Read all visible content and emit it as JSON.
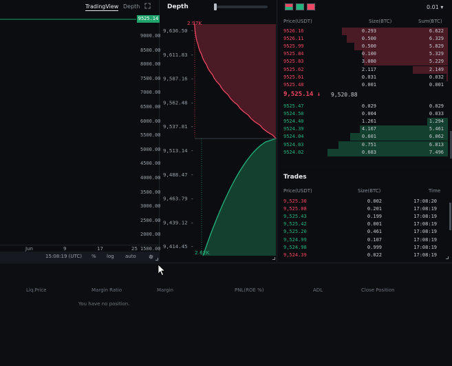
{
  "chart": {
    "tabs": [
      "TradingView",
      "Depth"
    ],
    "last_price_tag": "9525.14",
    "price_axis": [
      "9000.00",
      "8500.00",
      "8000.00",
      "7500.00",
      "7000.00",
      "6500.00",
      "6000.00",
      "5500.00",
      "5000.00",
      "4500.00",
      "4000.00",
      "3500.00",
      "3000.00",
      "2500.00",
      "2000.00",
      "1500.00"
    ],
    "time_axis": [
      "Jun",
      "9",
      "17",
      "25"
    ],
    "footer": {
      "time": "15:08:19 (UTC)",
      "percent": "%",
      "log": "log",
      "auto": "auto"
    }
  },
  "depth": {
    "title": "Depth",
    "y_axis": [
      "9,636.50 -",
      "9,611.83 -",
      "9,587.16 -",
      "9,562.48 -",
      "9,537.81 -",
      "9,513.14 -",
      "9,488.47 -",
      "9,463.79 -",
      "9,439.12 -",
      "9,414.45 -"
    ],
    "ask_total_label": "2.97K",
    "bid_total_label": "2.62K",
    "colors": {
      "ask": "#ef4663",
      "bid": "#23b47e"
    }
  },
  "order_book": {
    "precision": "0.01",
    "headers": {
      "price": "Price(USDT)",
      "size": "Size(BTC)",
      "sum": "Sum(BTC)"
    },
    "asks": [
      {
        "price": "9526.16",
        "size": "0.293",
        "sum": "6.622",
        "depth": 0.88
      },
      {
        "price": "9526.11",
        "size": "0.500",
        "sum": "6.329",
        "depth": 0.84
      },
      {
        "price": "9525.99",
        "size": "0.500",
        "sum": "5.829",
        "depth": 0.78
      },
      {
        "price": "9525.84",
        "size": "0.100",
        "sum": "5.329",
        "depth": 0.71
      },
      {
        "price": "9525.83",
        "size": "3.080",
        "sum": "5.229",
        "depth": 0.7
      },
      {
        "price": "9525.62",
        "size": "2.117",
        "sum": "2.149",
        "depth": 0.29
      },
      {
        "price": "9525.61",
        "size": "0.031",
        "sum": "0.032",
        "depth": 0.01
      },
      {
        "price": "9525.48",
        "size": "0.001",
        "sum": "0.001",
        "depth": 0.0
      }
    ],
    "mid_price": "9,525.14 ↓",
    "mark_price": "9,520.88",
    "bids": [
      {
        "price": "9525.47",
        "size": "0.029",
        "sum": "0.029",
        "depth": 0.0
      },
      {
        "price": "9524.50",
        "size": "0.004",
        "sum": "0.033",
        "depth": 0.0
      },
      {
        "price": "9524.40",
        "size": "1.261",
        "sum": "1.294",
        "depth": 0.17
      },
      {
        "price": "9524.39",
        "size": "4.167",
        "sum": "5.461",
        "depth": 0.73
      },
      {
        "price": "9524.04",
        "size": "0.601",
        "sum": "6.062",
        "depth": 0.81
      },
      {
        "price": "9524.03",
        "size": "0.751",
        "sum": "6.813",
        "depth": 0.91
      },
      {
        "price": "9524.02",
        "size": "0.683",
        "sum": "7.496",
        "depth": 1.0
      }
    ]
  },
  "trades": {
    "title": "Trades",
    "headers": {
      "price": "Price(USDT)",
      "size": "Size(BTC)",
      "time": "Time"
    },
    "rows": [
      {
        "price": "9,525.30",
        "size": "0.002",
        "time": "17:08:20",
        "side": "sell"
      },
      {
        "price": "9,525.08",
        "size": "0.201",
        "time": "17:08:19",
        "side": "sell"
      },
      {
        "price": "9,525.43",
        "size": "0.199",
        "time": "17:08:19",
        "side": "buy"
      },
      {
        "price": "9,525.42",
        "size": "0.001",
        "time": "17:08:19",
        "side": "buy"
      },
      {
        "price": "9,525.20",
        "size": "0.461",
        "time": "17:08:19",
        "side": "buy"
      },
      {
        "price": "9,524.99",
        "size": "0.107",
        "time": "17:08:19",
        "side": "buy"
      },
      {
        "price": "9,524.98",
        "size": "0.999",
        "time": "17:08:19",
        "side": "buy"
      },
      {
        "price": "9,524.39",
        "size": "0.022",
        "time": "17:08:19",
        "side": "sell"
      }
    ]
  },
  "positions": {
    "headers": [
      "Liq.Price",
      "Margin Ratio",
      "Margin",
      "PNL(ROE %)",
      "ADL",
      "Close Position"
    ],
    "empty_text": "You have no position."
  }
}
